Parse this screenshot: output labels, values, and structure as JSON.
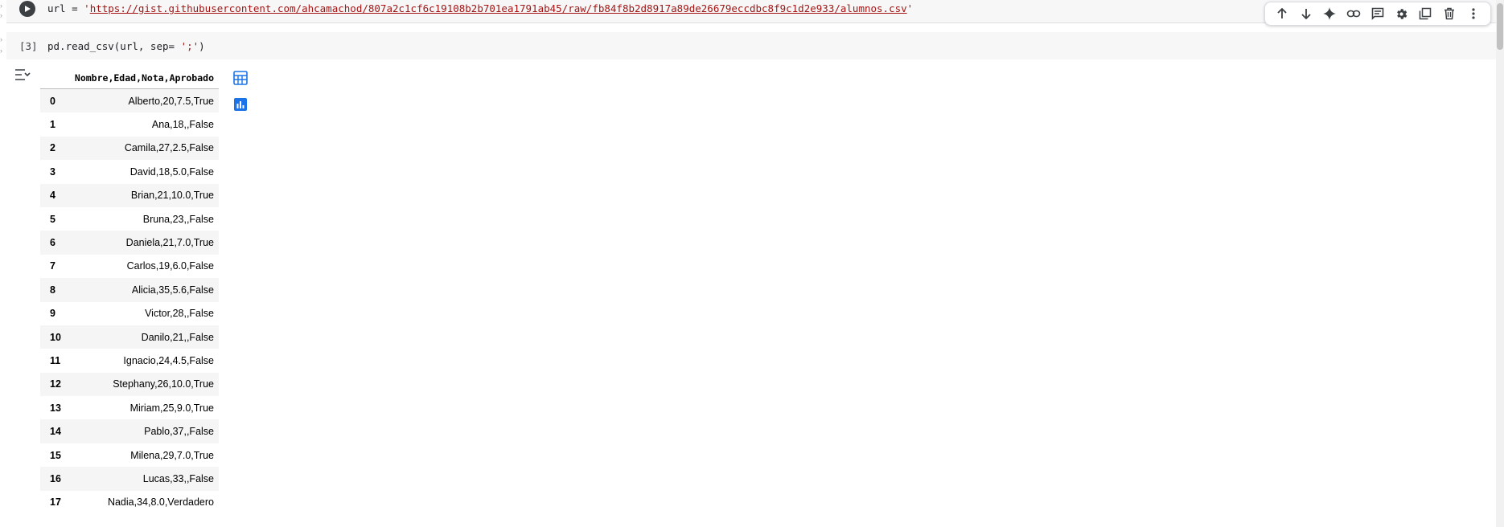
{
  "cell1": {
    "code_prefix": "url  = ",
    "quote_open": "'",
    "url": "https://gist.githubusercontent.com/ahcamachod/807a2c1cf6c19108b2b701ea1791ab45/raw/fb84f8b2d8917a89de26679eccdbc8f9c1d2e933/alumnos.csv",
    "quote_close": "'"
  },
  "toolbar": {
    "icons": [
      "arrow-up-icon",
      "arrow-down-icon",
      "gemini-sparkle-icon",
      "link-icon",
      "comment-icon",
      "gear-icon",
      "mirror-cell-icon",
      "trash-icon",
      "more-vert-icon"
    ]
  },
  "cell2": {
    "exec_count": "[3]",
    "code_a": "pd.read_csv(url, sep= ",
    "code_str": "';'",
    "code_b": ")"
  },
  "output": {
    "column_header": "Nombre,Edad,Nota,Aprobado",
    "rows": [
      {
        "index": "0",
        "value": "Alberto,20,7.5,True"
      },
      {
        "index": "1",
        "value": "Ana,18,,False"
      },
      {
        "index": "2",
        "value": "Camila,27,2.5,False"
      },
      {
        "index": "3",
        "value": "David,18,5.0,False"
      },
      {
        "index": "4",
        "value": "Brian,21,10.0,True"
      },
      {
        "index": "5",
        "value": "Bruna,23,,False"
      },
      {
        "index": "6",
        "value": "Daniela,21,7.0,True"
      },
      {
        "index": "7",
        "value": "Carlos,19,6.0,False"
      },
      {
        "index": "8",
        "value": "Alicia,35,5.6,False"
      },
      {
        "index": "9",
        "value": "Victor,28,,False"
      },
      {
        "index": "10",
        "value": "Danilo,21,,False"
      },
      {
        "index": "11",
        "value": "Ignacio,24,4.5,False"
      },
      {
        "index": "12",
        "value": "Stephany,26,10.0,True"
      },
      {
        "index": "13",
        "value": "Miriam,25,9.0,True"
      },
      {
        "index": "14",
        "value": "Pablo,37,,False"
      },
      {
        "index": "15",
        "value": "Milena,29,7.0,True"
      },
      {
        "index": "16",
        "value": "Lucas,33,,False"
      },
      {
        "index": "17",
        "value": "Nadia,34,8.0,Verdadero"
      }
    ]
  },
  "colors": {
    "accent": "#1a73e8",
    "string": "#a31515",
    "cell_bg": "#f7f7f7"
  }
}
